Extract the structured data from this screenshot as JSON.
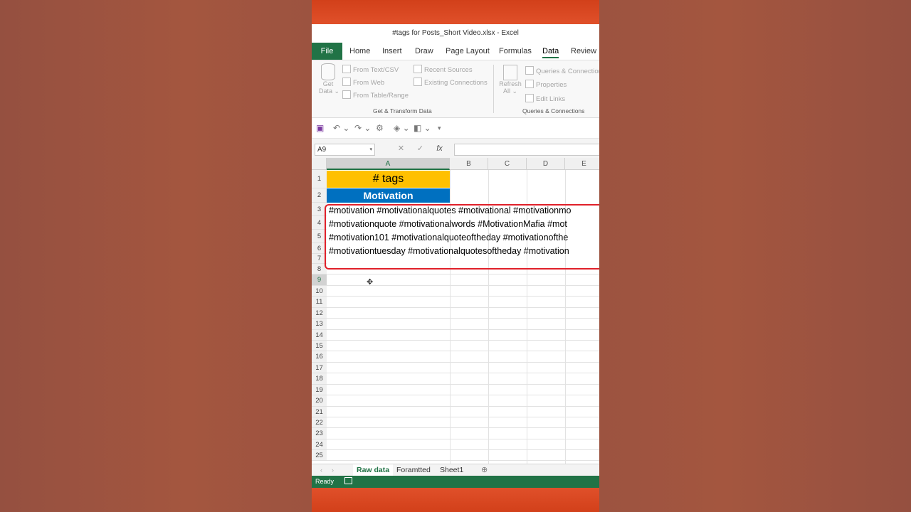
{
  "window": {
    "title": "#tags for Posts_Short Video.xlsx  -  Excel"
  },
  "ribbon_tabs": [
    "File",
    "Home",
    "Insert",
    "Draw",
    "Page Layout",
    "Formulas",
    "Data",
    "Review"
  ],
  "active_tab": "Data",
  "ribbon": {
    "get_data": "Get",
    "get_data2": "Data",
    "from_text_csv": "From Text/CSV",
    "from_web": "From Web",
    "from_table_range": "From Table/Range",
    "recent_sources": "Recent Sources",
    "existing_connections": "Existing Connections",
    "group_get_transform": "Get & Transform Data",
    "refresh": "Refresh",
    "refresh2": "All",
    "queries_connections": "Queries & Connections",
    "properties": "Properties",
    "edit_links": "Edit Links",
    "group_queries": "Queries & Connections"
  },
  "formula_bar": {
    "name_box": "A9",
    "fx": "fx",
    "cancel": "✕",
    "enter": "✓"
  },
  "columns": [
    "A",
    "B",
    "C",
    "D",
    "E"
  ],
  "rows": [
    "1",
    "2",
    "3",
    "4",
    "5",
    "6",
    "7",
    "8",
    "9",
    "10",
    "11",
    "12",
    "13",
    "14",
    "15",
    "16",
    "17",
    "18",
    "19",
    "20",
    "21",
    "22",
    "23",
    "24",
    "25"
  ],
  "cells": {
    "a1": "# tags",
    "a2": "Motivation",
    "line1": "#motivation #motivationalquotes #motivational #motivationmo",
    "line2": "#motivationquote #motivationalwords #MotivationMafia #mot",
    "line3": "#motivation101 #motivationalquoteoftheday #motivationofthe",
    "line4": "#motivationtuesday #motivationalquotesoftheday #motivation"
  },
  "sheets": [
    "Raw data",
    "Foramtted",
    "Sheet1"
  ],
  "active_sheet": "Raw data",
  "status": {
    "ready": "Ready"
  },
  "colors": {
    "excel_green": "#217346",
    "header_yellow": "#ffc000",
    "header_blue": "#0070c0",
    "annotation_red": "#e0202a"
  }
}
